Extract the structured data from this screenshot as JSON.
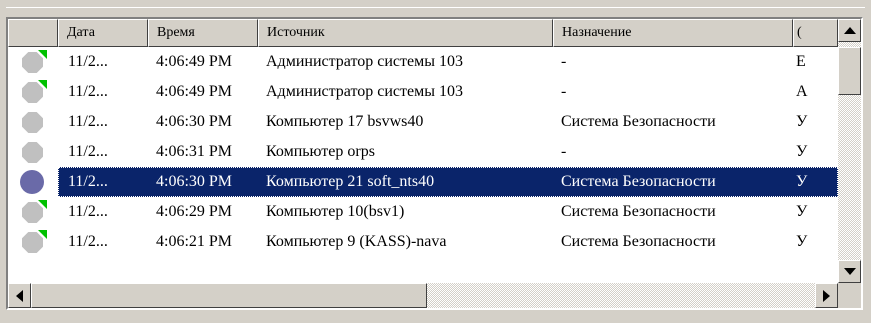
{
  "columns": [
    "",
    "Дата",
    "Время",
    "Источник",
    "Назначение",
    "("
  ],
  "rows": [
    {
      "status": "gray-flag",
      "date": "11/2...",
      "time": "4:06:49 PM",
      "source": "Администратор системы 103",
      "dest": "-",
      "extra": "E"
    },
    {
      "status": "gray-flag",
      "date": "11/2...",
      "time": "4:06:49 PM",
      "source": "Администратор системы 103",
      "dest": "-",
      "extra": "A"
    },
    {
      "status": "gray",
      "date": "11/2...",
      "time": "4:06:30 PM",
      "source": "Компьютер 17 bsvws40",
      "dest": "Система Безопасности",
      "extra": "У"
    },
    {
      "status": "gray",
      "date": "11/2...",
      "time": "4:06:31 PM",
      "source": "Компьютер orps",
      "dest": "-",
      "extra": "У"
    },
    {
      "status": "blue",
      "date": "11/2...",
      "time": "4:06:30 PM",
      "source": "Компьютер 21 soft_nts40",
      "dest": "Система Безопасности",
      "extra": "У",
      "selected": true
    },
    {
      "status": "gray-flag",
      "date": "11/2...",
      "time": "4:06:29 PM",
      "source": "Компьютер 10(bsv1)",
      "dest": "Система Безопасности",
      "extra": "У"
    },
    {
      "status": "gray-flag",
      "date": "11/2...",
      "time": "4:06:21 PM",
      "source": "Компьютер 9 (KASS)-nava",
      "dest": "Система Безопасности",
      "extra": "У"
    }
  ],
  "colors": {
    "selection": "#0a246a",
    "flag": "#00c000",
    "status_gray": "#c0c0c0",
    "status_blue": "#6a6aa8"
  },
  "icons": {
    "scroll_up": "arrow-up-icon",
    "scroll_down": "arrow-down-icon",
    "scroll_left": "arrow-left-icon",
    "scroll_right": "arrow-right-icon"
  }
}
